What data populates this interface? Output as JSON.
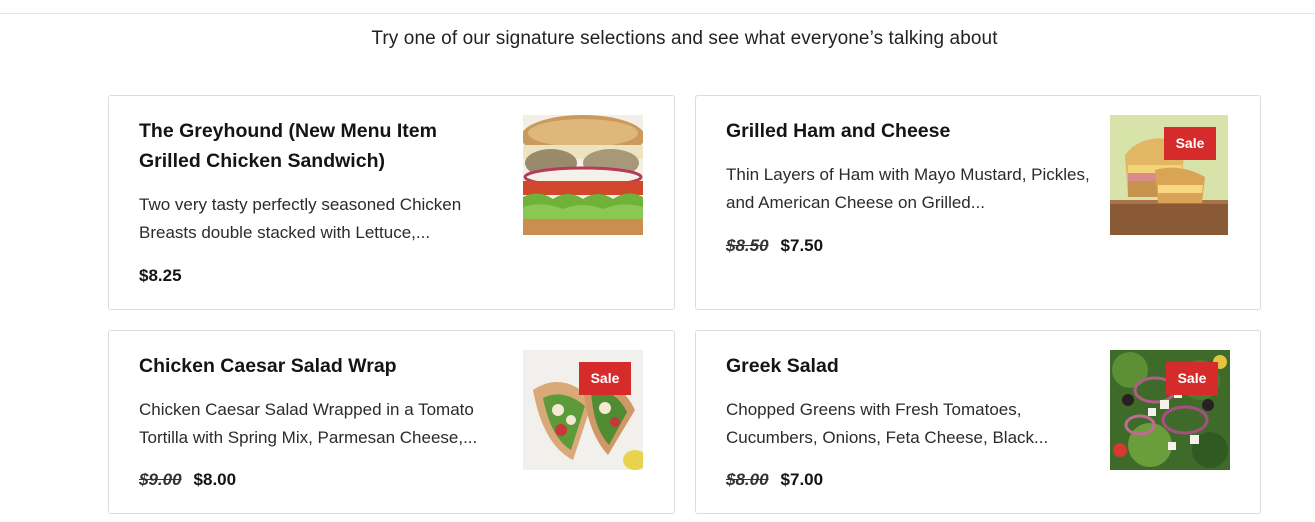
{
  "header": {
    "tagline": "Try one of our signature selections and see what everyone’s talking about"
  },
  "colors": {
    "sale_badge": "#d62b2b",
    "card_border": "#dcdcdc"
  },
  "items": [
    {
      "title": "The Greyhound (New Menu Item Grilled Chicken Sandwich)",
      "description": "Two very tasty perfectly seasoned Chicken Breasts double stacked with Lettuce,...",
      "old_price": "",
      "price": "$8.25",
      "sale": false,
      "sale_label": "",
      "image_icon": "chicken-sandwich-image"
    },
    {
      "title": "Grilled Ham and Cheese",
      "description": "Thin Layers of Ham with Mayo Mustard, Pickles, and American Cheese on Grilled...",
      "old_price": "$8.50",
      "price": "$7.50",
      "sale": true,
      "sale_label": "Sale",
      "image_icon": "ham-cheese-image"
    },
    {
      "title": "Chicken Caesar Salad Wrap",
      "description": "Chicken Caesar Salad Wrapped in a Tomato Tortilla with Spring Mix, Parmesan Cheese,...",
      "old_price": "$9.00",
      "price": "$8.00",
      "sale": true,
      "sale_label": "Sale",
      "image_icon": "caesar-wrap-image"
    },
    {
      "title": "Greek Salad",
      "description": "Chopped Greens with Fresh Tomatoes, Cucumbers, Onions, Feta Cheese, Black...",
      "old_price": "$8.00",
      "price": "$7.00",
      "sale": true,
      "sale_label": "Sale",
      "image_icon": "greek-salad-image"
    }
  ]
}
